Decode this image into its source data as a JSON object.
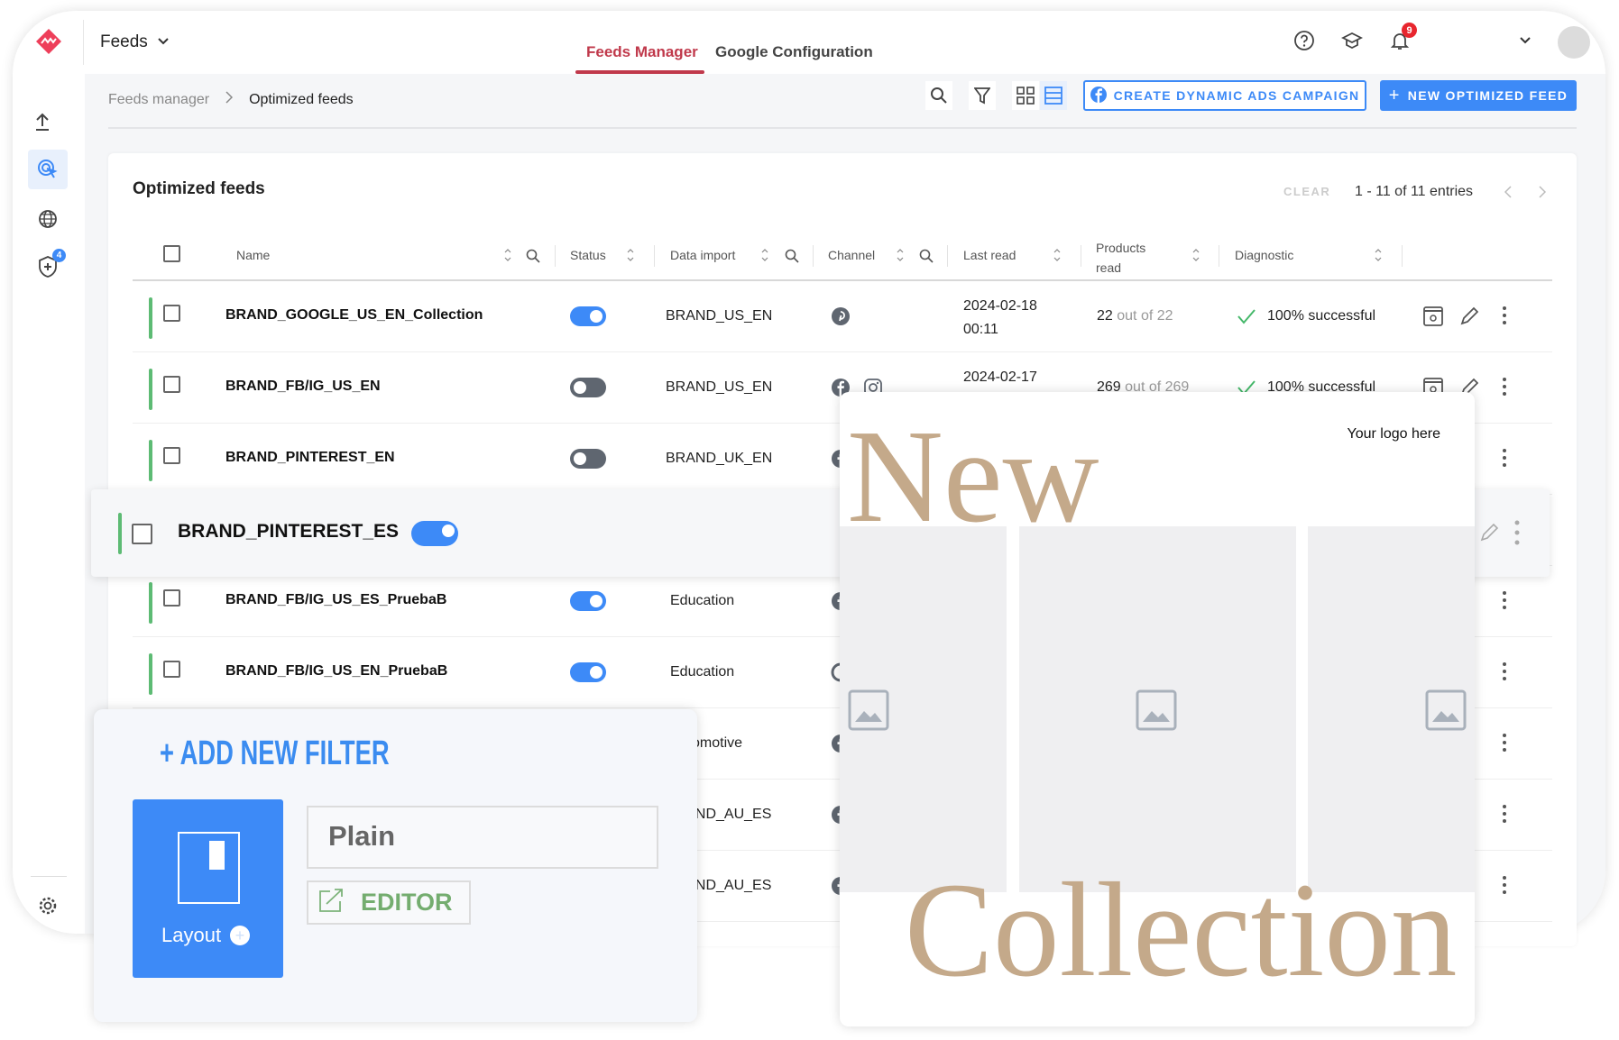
{
  "topbar": {
    "app_menu": "Feeds",
    "tabs": [
      {
        "label": "Feeds Manager",
        "active": true
      },
      {
        "label": "Google Configuration",
        "active": false
      }
    ],
    "notification_count": "9",
    "accent": "#c0394b"
  },
  "sidebar": {
    "items": [
      "upload-icon",
      "optimize-cursor-icon",
      "globe-icon",
      "shield-plus-icon"
    ],
    "shield_badge": "4",
    "footer": "gear-icon"
  },
  "breadcrumb": {
    "parent": "Feeds manager",
    "current": "Optimized feeds"
  },
  "toolbar": {
    "create_campaign": "CREATE DYNAMIC ADS CAMPAIGN",
    "new_feed": "NEW OPTIMIZED FEED",
    "primary_color": "#3d8af7"
  },
  "table": {
    "title": "Optimized feeds",
    "clear": "CLEAR",
    "entries": "1 - 11 of 11 entries",
    "columns": [
      "Name",
      "Status",
      "Data import",
      "Channel",
      "Last read",
      "Products read",
      "Diagnostic"
    ],
    "rows": [
      {
        "name": "BRAND_GOOGLE_US_EN_Collection",
        "status": "on",
        "data_import": "BRAND_US_EN",
        "channels": [
          "pinterest"
        ],
        "date": "2024-02-18",
        "time": "00:11",
        "products": "22",
        "products_total": "out of 22",
        "diagnostic": "100% successful"
      },
      {
        "name": "BRAND_FB/IG_US_EN",
        "status": "off",
        "data_import": "BRAND_US_EN",
        "channels": [
          "facebook",
          "instagram"
        ],
        "date": "2024-02-17",
        "time": "",
        "products": "269",
        "products_total": "out of 269",
        "diagnostic": "100% successful"
      },
      {
        "name": "BRAND_PINTEREST_EN",
        "status": "off",
        "data_import": "BRAND_UK_EN",
        "channels": [
          "facebook"
        ]
      },
      {
        "name": "",
        "status": "",
        "data_import": "",
        "channels": []
      },
      {
        "name": "BRAND_FB/IG_US_ES_PruebaB",
        "status": "on",
        "data_import": "Education",
        "channels": [
          "facebook"
        ]
      },
      {
        "name": "BRAND_FB/IG_US_EN_PruebaB",
        "status": "on",
        "data_import": "Education",
        "channels": [
          "google"
        ]
      },
      {
        "name": "",
        "status": "",
        "data_import": "Automotive",
        "channels": [
          "facebook"
        ]
      },
      {
        "name": "",
        "status": "",
        "data_import": "BRAND_AU_ES",
        "channels": [
          "facebook"
        ]
      },
      {
        "name": "",
        "status": "",
        "data_import": "BRAND_AU_ES",
        "channels": [
          "facebook"
        ]
      }
    ],
    "highlighted": {
      "name": "BRAND_PINTEREST_ES",
      "status": "on"
    }
  },
  "preview": {
    "logo_text": "Your logo here",
    "headline_1": "New",
    "headline_2": "Collection",
    "headline_color": "#c4a98a"
  },
  "filter_panel": {
    "add_filter": "+ ADD NEW FILTER",
    "layout_label": "Layout",
    "template_value": "Plain",
    "editor_label": "EDITOR"
  }
}
